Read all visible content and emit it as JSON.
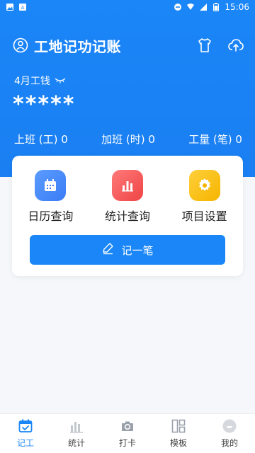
{
  "status_bar": {
    "time": "15:06"
  },
  "header": {
    "title": "工地记功记账"
  },
  "summary": {
    "month_label": "4月工钱",
    "hidden_amount": "*****",
    "work_label": "上班 (工) 0",
    "overtime_label": "加班 (时) 0",
    "quantity_label": "工量 (笔) 0"
  },
  "features": [
    {
      "label": "日历查询",
      "color": "#3b82f6"
    },
    {
      "label": "统计查询",
      "color": "#ef4444"
    },
    {
      "label": "项目设置",
      "color": "#f59e0b"
    }
  ],
  "primary_action": {
    "label": "记一笔"
  },
  "bottom_nav": [
    {
      "label": "记工",
      "icon": "calendar-check-icon"
    },
    {
      "label": "统计",
      "icon": "bar-chart-icon"
    },
    {
      "label": "打卡",
      "icon": "camera-icon"
    },
    {
      "label": "模板",
      "icon": "layout-icon"
    },
    {
      "label": "我的",
      "icon": "profile-icon"
    }
  ],
  "colors": {
    "brand": "#1a86f7",
    "active": "#1a86f7",
    "inactive_icon": "#9aa1aa"
  }
}
